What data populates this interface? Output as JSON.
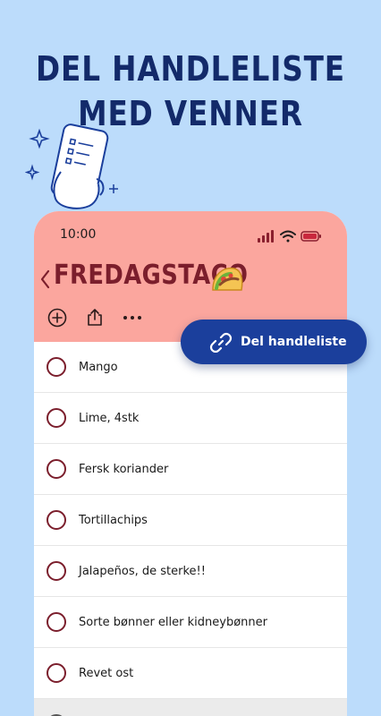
{
  "headline": {
    "line1": "DEL HANDLELISTE",
    "line2": "MED VENNER"
  },
  "status_bar": {
    "time": "10:00"
  },
  "list": {
    "title": "FREDAGSTACO",
    "title_emoji_icon": "taco-icon",
    "actions": [
      "add-icon",
      "share-icon",
      "more-icon"
    ],
    "items": [
      {
        "label": "Mango"
      },
      {
        "label": "Lime, 4stk"
      },
      {
        "label": "Fersk koriander"
      },
      {
        "label": "Tortillachips"
      },
      {
        "label": "Jalapeños, de sterke!!"
      },
      {
        "label": "Sorte bønner eller kidneybønner"
      },
      {
        "label": "Revet ost"
      },
      {
        "label": ""
      }
    ]
  },
  "share_button": {
    "label": "Del handleliste",
    "icon": "link-icon"
  },
  "colors": {
    "background": "#bcdcfb",
    "headline": "#132a6a",
    "header": "#fba69e",
    "title": "#7b1e2c",
    "share_button": "#1b3f9c"
  }
}
